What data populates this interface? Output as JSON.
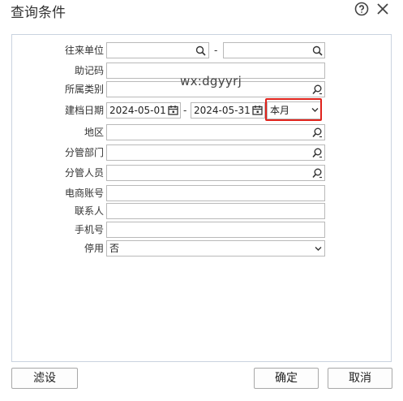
{
  "dialog": {
    "title": "查询条件",
    "help_icon": "help-circle-icon",
    "close_icon": "close-icon"
  },
  "form": {
    "partner": {
      "label": "往来单位",
      "from": "",
      "to": "",
      "range_sep": "-"
    },
    "mnemonic": {
      "label": "助记码",
      "value": ""
    },
    "category": {
      "label": "所属类别",
      "value": ""
    },
    "created_date": {
      "label": "建档日期",
      "from": "2024-05-01",
      "to": "2024-05-31",
      "range_sep": "-",
      "period": "本月"
    },
    "region": {
      "label": "地区",
      "value": ""
    },
    "department": {
      "label": "分管部门",
      "value": ""
    },
    "staff": {
      "label": "分管人员",
      "value": ""
    },
    "ecommerce_account": {
      "label": "电商账号",
      "value": ""
    },
    "contact": {
      "label": "联系人",
      "value": ""
    },
    "mobile": {
      "label": "手机号",
      "value": ""
    },
    "disabled": {
      "label": "停用",
      "value": "否"
    }
  },
  "watermark": "wx:dgyyrj",
  "buttons": {
    "filter": "滤设",
    "ok": "确定",
    "cancel": "取消"
  },
  "colors": {
    "highlight": "#e0231c",
    "panel_border": "#c9d3df"
  }
}
